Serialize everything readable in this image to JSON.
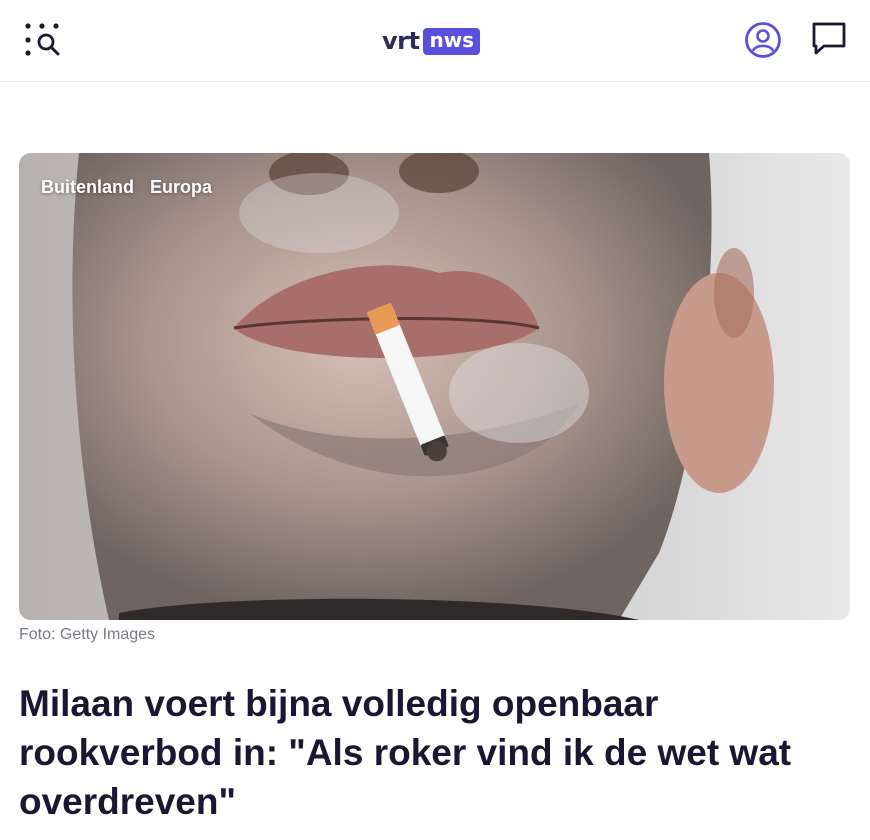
{
  "header": {
    "logo_left": "vrt",
    "logo_right": "nws",
    "icons": [
      "menu-search-icon",
      "user-icon",
      "chat-icon"
    ],
    "accent_color": "#5b4fe0"
  },
  "hero": {
    "tags": [
      "Buitenland",
      "Europa"
    ],
    "caption": "Foto: Getty Images"
  },
  "article": {
    "headline": "Milaan voert bijna volledig openbaar rookverbod in: \"Als roker vind ik de wet wat overdreven\""
  }
}
